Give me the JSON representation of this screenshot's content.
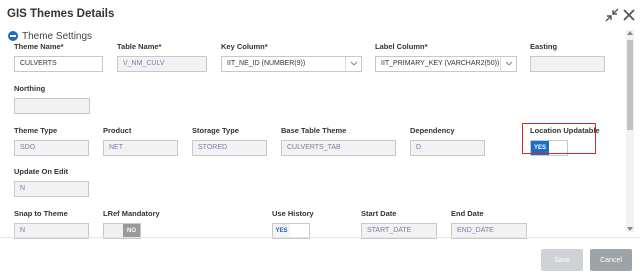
{
  "dialog": {
    "title": "GIS Themes Details",
    "section_title": "Theme Settings"
  },
  "fields": {
    "theme_name": {
      "label": "Theme Name*",
      "value": "CULVERTS"
    },
    "table_name": {
      "label": "Table Name*",
      "value": "V_NM_CULV"
    },
    "key_column": {
      "label": "Key Column*",
      "value": "IIT_NE_ID (NUMBER(9))"
    },
    "label_column": {
      "label": "Label Column*",
      "value": "IIT_PRIMARY_KEY (VARCHAR2(50))"
    },
    "easting": {
      "label": "Easting",
      "value": ""
    },
    "northing": {
      "label": "Northing",
      "value": ""
    },
    "theme_type": {
      "label": "Theme Type",
      "value": "SDO"
    },
    "product": {
      "label": "Product",
      "value": "NET"
    },
    "storage_type": {
      "label": "Storage Type",
      "value": "STORED"
    },
    "base_table_theme": {
      "label": "Base Table Theme",
      "value": "CULVERTS_TAB"
    },
    "dependency": {
      "label": "Dependency",
      "value": "D"
    },
    "location_updatable": {
      "label": "Location Updatable",
      "on_text": "YES"
    },
    "update_on_edit": {
      "label": "Update On Edit",
      "value": "N"
    },
    "snap_to_theme": {
      "label": "Snap to Theme",
      "value": "N"
    },
    "lref_mandatory": {
      "label": "LRef Mandatory",
      "off_text": "NO"
    },
    "use_history": {
      "label": "Use History",
      "on_text": "YES"
    },
    "start_date": {
      "label": "Start Date",
      "value": "START_DATE"
    },
    "end_date": {
      "label": "End Date",
      "value": "END_DATE"
    }
  },
  "buttons": {
    "save": "Save",
    "cancel": "Cancel"
  },
  "colors": {
    "accent": "#1a6fc4",
    "highlight": "#d9282a"
  }
}
